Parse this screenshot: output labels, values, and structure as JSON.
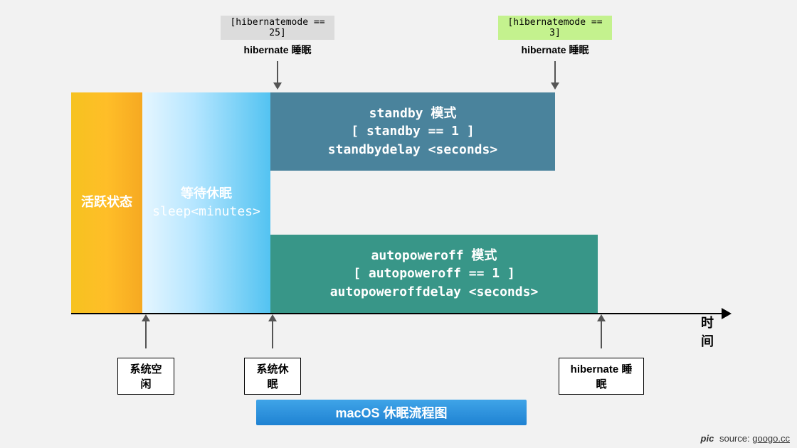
{
  "blocks": {
    "active": {
      "label": "活跃状态"
    },
    "sleep": {
      "line1": "等待休眠",
      "line2": "sleep<minutes>"
    },
    "standby": {
      "line1": "standby 模式",
      "line2": "[ standby == 1 ]",
      "line3": "standbydelay <seconds>"
    },
    "autopoweroff": {
      "line1": "autopoweroff 模式",
      "line2": "[ autopoweroff == 1 ]",
      "line3": "autopoweroffdelay <seconds>"
    }
  },
  "axis_label": "时间",
  "top_annotations": {
    "left": {
      "code": "[hibernatemode == 25]",
      "label": "hibernate 睡眠"
    },
    "right": {
      "code": "[hibernatemode == 3]",
      "label": "hibernate 睡眠"
    }
  },
  "bottom_annotations": {
    "idle": "系统空闲",
    "sleep": "系统休眠",
    "hibernate": "hibernate 睡眠"
  },
  "caption": "macOS 休眠流程图",
  "source": {
    "prefix": "pic",
    "text": "source:",
    "link": "googo.cc"
  },
  "chart_data": {
    "type": "timeline",
    "title": "macOS 休眠流程图",
    "x_axis": "时间",
    "phases": [
      {
        "name": "活跃状态",
        "start": 0,
        "end": 1,
        "color": "#f6b020"
      },
      {
        "name": "等待休眠",
        "condition": "sleep<minutes>",
        "start": 1,
        "end": 2,
        "color": "#53c3f1"
      },
      {
        "name": "standby 模式",
        "condition": "[ standby == 1 ]",
        "delay": "standbydelay <seconds>",
        "start": 2,
        "end": 3,
        "track": "upper",
        "color": "#4a839c"
      },
      {
        "name": "autopoweroff 模式",
        "condition": "[ autopoweroff == 1 ]",
        "delay": "autopoweroffdelay <seconds>",
        "start": 2,
        "end": 3.3,
        "track": "lower",
        "color": "#389688"
      }
    ],
    "events_above": [
      {
        "at_phase_end": "等待休眠",
        "condition": "[hibernatemode == 25]",
        "action": "hibernate 睡眠"
      },
      {
        "at_phase_end": "standby 模式",
        "condition": "[hibernatemode == 3]",
        "action": "hibernate 睡眠"
      }
    ],
    "events_below": [
      {
        "at_phase_boundary": 1,
        "label": "系统空闲"
      },
      {
        "at_phase_boundary": 2,
        "label": "系统休眠"
      },
      {
        "at_phase_end": "autopoweroff 模式",
        "label": "hibernate 睡眠"
      }
    ]
  }
}
